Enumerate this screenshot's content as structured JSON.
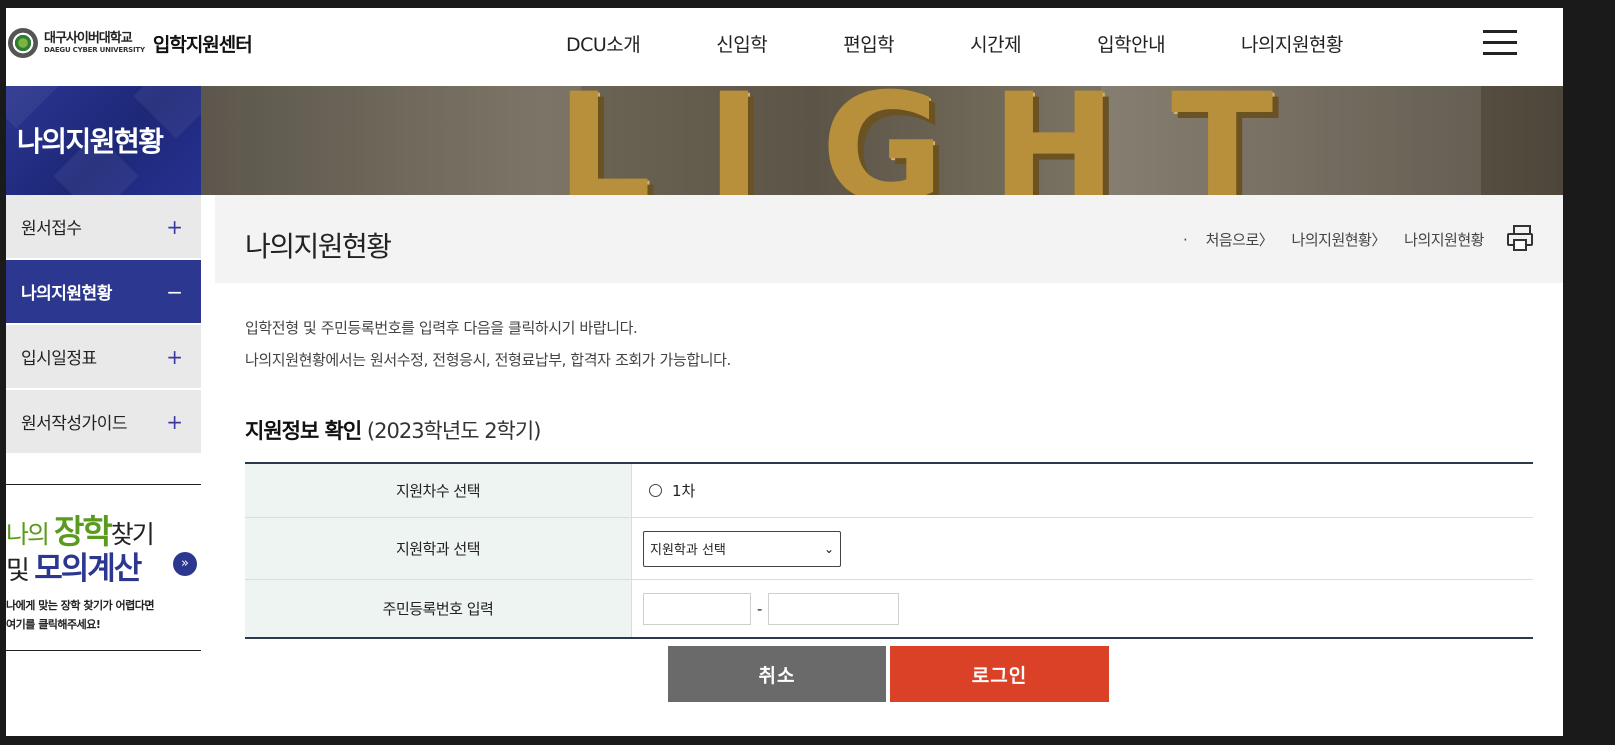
{
  "header": {
    "logo_kr": "대구사이버대학교",
    "logo_en": "DAEGU CYBER UNIVERSITY",
    "logo_center": "입학지원센터",
    "nav": [
      "DCU소개",
      "신입학",
      "편입학",
      "시간제",
      "입학안내",
      "나의지원현황"
    ]
  },
  "sidebar": {
    "title": "나의지원현황",
    "items": [
      {
        "label": "원서접수",
        "toggle": "+"
      },
      {
        "label": "나의지원현황",
        "toggle": "−"
      },
      {
        "label": "입시일정표",
        "toggle": "+"
      },
      {
        "label": "원서작성가이드",
        "toggle": "+"
      }
    ],
    "banner": {
      "line1_a": "나의 ",
      "line1_b": "장학",
      "line1_c": "찾기",
      "line2_a": "및 ",
      "line2_b": "모의계산",
      "arrow": "»",
      "sub1": "나에게 맞는 장학 찾기가 어렵다면",
      "sub2": "여기를 클릭해주세요!"
    }
  },
  "hero": {
    "letters": [
      "L",
      "I",
      "G",
      "H",
      "T"
    ]
  },
  "content": {
    "page_title": "나의지원현황",
    "breadcrumb": [
      "·",
      "처음으로〉",
      "나의지원현황〉",
      "나의지원현황"
    ],
    "intro1": "입학전형 및 주민등록번호를 입력후 다음을 클릭하시기 바랍니다.",
    "intro2": "나의지원현황에서는 원서수정, 전형응시, 전형료납부, 합격자 조회가 가능합니다.",
    "section_title": "지원정보 확인",
    "section_semester": "(2023학년도 2학기)",
    "form": {
      "round_label": "지원차수 선택",
      "round_option": "1차",
      "dept_label": "지원학과 선택",
      "dept_select_value": "지원학과 선택",
      "ssn_label": "주민등록번호 입력",
      "ssn_dash": "-"
    },
    "buttons": {
      "cancel": "취소",
      "login": "로그인"
    }
  },
  "colors": {
    "brand_navy": "#2c3790",
    "login_red": "#db4127",
    "cancel_gray": "#6a6a6a",
    "table_header_bg": "#eef4f2"
  }
}
